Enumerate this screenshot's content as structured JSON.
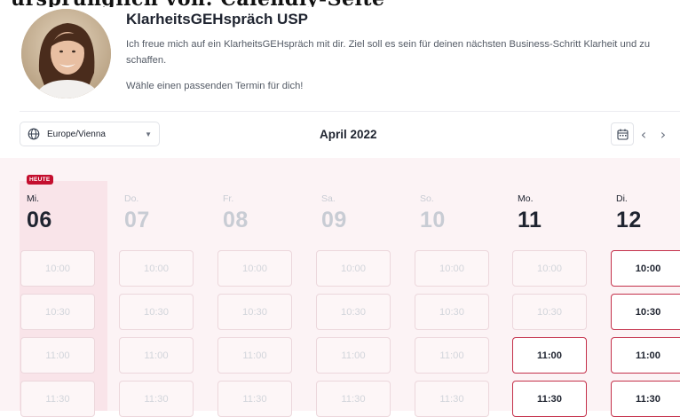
{
  "header_cut_text": "ursprünglich von: Calendly-Seite",
  "profile": {
    "title": "KlarheitsGEHspräch USP",
    "description": "Ich freue mich auf ein KlarheitsGEHspräch mit dir. Ziel soll es sein für deinen nächsten Business-Schritt Klarheit und zu schaffen.",
    "instruction": "Wähle einen passenden Termin für dich!"
  },
  "toolbar": {
    "timezone": "Europe/Vienna",
    "month": "April 2022"
  },
  "today_badge": "HEUTE",
  "colors": {
    "accent": "#c40e2e",
    "available_border": "#c4304a"
  },
  "days": [
    {
      "weekday": "Mi.",
      "date": "06"
    },
    {
      "weekday": "Do.",
      "date": "07"
    },
    {
      "weekday": "Fr.",
      "date": "08"
    },
    {
      "weekday": "Sa.",
      "date": "09"
    },
    {
      "weekday": "So.",
      "date": "10"
    },
    {
      "weekday": "Mo.",
      "date": "11"
    },
    {
      "weekday": "Di.",
      "date": "12"
    }
  ],
  "times": [
    "10:00",
    "10:30",
    "11:00",
    "11:30"
  ]
}
